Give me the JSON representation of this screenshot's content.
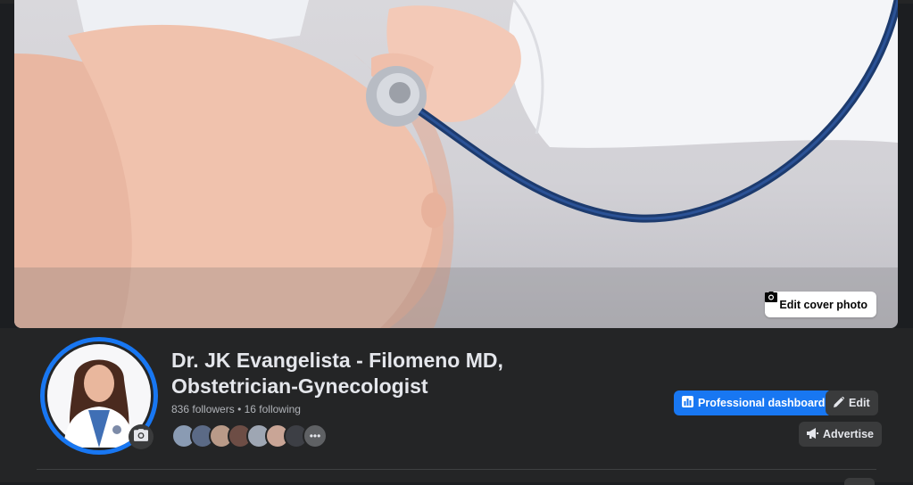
{
  "cover": {
    "edit_label": "Edit cover photo"
  },
  "profile": {
    "name_line1": "Dr. JK Evangelista - Filomeno MD,",
    "name_line2": "Obstetrician-Gynecologist",
    "followers": "836 followers",
    "separator": "•",
    "following": "16 following"
  },
  "actions": {
    "dashboard_label": "Professional dashboard",
    "edit_label": "Edit",
    "advertise_label": "Advertise"
  },
  "colors": {
    "accent": "#1877f2",
    "background": "#242526",
    "button_gray": "#3a3b3c"
  }
}
